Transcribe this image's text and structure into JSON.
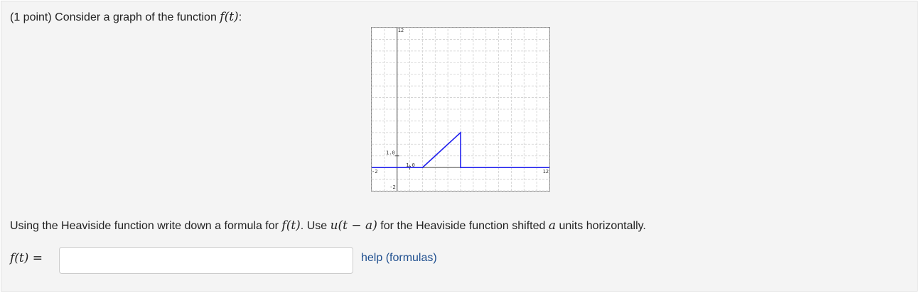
{
  "question": {
    "points": "(1 point) Consider a graph of the function ",
    "func": "f(t)",
    "colon": ":"
  },
  "instructions": {
    "text1": "Using the Heaviside function write down a formula for ",
    "func": "f(t)",
    "text2": ". Use ",
    "heaviside": "u(t − a)",
    "text3": " for the Heaviside function shifted ",
    "a": "a",
    "text4": " units horizontally."
  },
  "answer": {
    "label": "f(t) =",
    "value": "",
    "placeholder": ""
  },
  "help_link": "help (formulas)",
  "colors": {
    "curve": "#2222ee",
    "grid": "#cfcfcf",
    "axis": "#444444",
    "link": "#1f4f8f"
  },
  "chart_data": {
    "type": "line",
    "xlim": [
      -2,
      12
    ],
    "ylim": [
      -2,
      12
    ],
    "grid": true,
    "tick_labels": {
      "y_top": "12",
      "y_one": "1.0",
      "x_one": "1.0",
      "x_left": "-2",
      "x_right": "12",
      "y_bottom": "-2"
    },
    "series": [
      {
        "x": [
          -2,
          2,
          5,
          5,
          12
        ],
        "y": [
          0,
          0,
          3,
          0,
          0
        ]
      }
    ]
  }
}
